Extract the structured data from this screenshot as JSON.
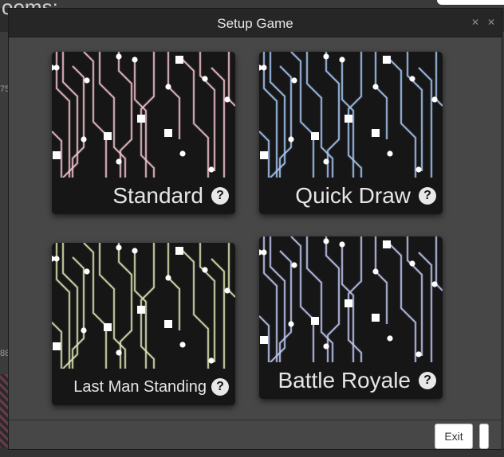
{
  "background": {
    "title_fragment": "ooms:",
    "left_numbers": [
      "75",
      "88"
    ]
  },
  "dialog": {
    "title": "Setup Game",
    "buttons": {
      "minimize_symbol": "✕",
      "close_symbol": "✕"
    },
    "modes": [
      {
        "label": "Standard",
        "accent": "#f2c4cc",
        "help_symbol": "?",
        "help_icon": "question-circle-icon"
      },
      {
        "label": "Quick Draw",
        "accent": "#a8c8f4",
        "help_symbol": "?",
        "help_icon": "question-circle-icon"
      },
      {
        "label": "Last Man Standing",
        "accent": "#dbe6b4",
        "help_symbol": "?",
        "help_icon": "question-circle-icon"
      },
      {
        "label": "Battle Royale",
        "accent": "#c0c8f2",
        "help_symbol": "?",
        "help_icon": "question-circle-icon"
      }
    ],
    "footer": {
      "exit_label": "Exit"
    }
  }
}
